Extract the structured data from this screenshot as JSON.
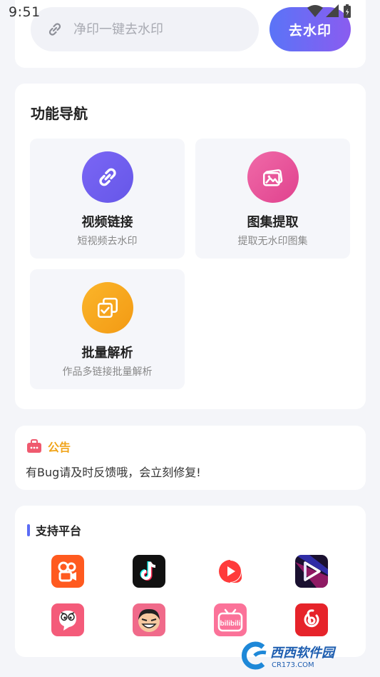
{
  "status_bar": {
    "time": "9:51"
  },
  "search": {
    "placeholder": "净印一键去水印",
    "button_label": "去水印"
  },
  "nav": {
    "title": "功能导航",
    "tiles": [
      {
        "title": "视频链接",
        "subtitle": "短视频去水印",
        "icon": "link-icon",
        "color": "#6f5ff2"
      },
      {
        "title": "图集提取",
        "subtitle": "提取无水印图集",
        "icon": "image-icon",
        "color": "#ea559c"
      },
      {
        "title": "批量解析",
        "subtitle": "作品多链接批量解析",
        "icon": "stack-icon",
        "color": "#f7a61f"
      }
    ]
  },
  "notice": {
    "title": "公告",
    "text": "有Bug请及时反馈哦，会立刻修复!"
  },
  "platforms": {
    "title": "支持平台",
    "items": [
      {
        "name": "kuaishou-icon",
        "color": "#ff5a1f"
      },
      {
        "name": "tiktok-icon",
        "color": "#111111"
      },
      {
        "name": "weishi-icon",
        "color": "#ff3b3b"
      },
      {
        "name": "video-platform-icon",
        "color": "#1a1030"
      },
      {
        "name": "pipixia-icon",
        "color": "#f45b7a"
      },
      {
        "name": "zuiyou-icon",
        "color": "#f06a8a"
      },
      {
        "name": "bilibili-icon",
        "color": "#fb7299"
      },
      {
        "name": "netease-music-icon",
        "color": "#e6232a"
      }
    ]
  },
  "watermark": {
    "text": "西西软件园",
    "sub": "CR173.COM"
  }
}
